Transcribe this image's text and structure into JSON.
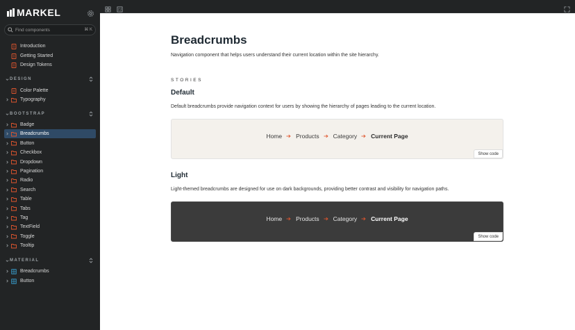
{
  "sidebar": {
    "brand": "MARKEL",
    "search": {
      "placeholder": "Find components",
      "shortcut": "⌘ K"
    },
    "top_items": [
      {
        "label": "Introduction",
        "icon": "document-icon"
      },
      {
        "label": "Getting Started",
        "icon": "document-icon"
      },
      {
        "label": "Design Tokens",
        "icon": "document-icon"
      }
    ],
    "sections": [
      {
        "title": "DESIGN",
        "items": [
          {
            "label": "Color Palette",
            "icon": "document-icon"
          },
          {
            "label": "Typography",
            "icon": "folder-icon"
          }
        ]
      },
      {
        "title": "BOOTSTRAP",
        "items": [
          {
            "label": "Badge"
          },
          {
            "label": "Breadcrumbs",
            "selected": true
          },
          {
            "label": "Button"
          },
          {
            "label": "Checkbox"
          },
          {
            "label": "Dropdown"
          },
          {
            "label": "Pagination"
          },
          {
            "label": "Radio"
          },
          {
            "label": "Search"
          },
          {
            "label": "Table"
          },
          {
            "label": "Tabs"
          },
          {
            "label": "Tag"
          },
          {
            "label": "TextField"
          },
          {
            "label": "Toggle"
          },
          {
            "label": "Tooltip"
          }
        ]
      },
      {
        "title": "MATERIAL",
        "items": [
          {
            "label": "Breadcrumbs",
            "icon": "component-icon"
          },
          {
            "label": "Button",
            "icon": "component-icon"
          }
        ]
      }
    ]
  },
  "page": {
    "title": "Breadcrumbs",
    "description": "Navigation component that helps users understand their current location within the site hierarchy.",
    "stories_label": "STORIES",
    "stories": [
      {
        "title": "Default",
        "description": "Default breadcrumbs provide navigation context for users by showing the hierarchy of pages leading to the current location.",
        "crumbs": [
          "Home",
          "Products",
          "Category",
          "Current Page"
        ],
        "show_code": "Show code",
        "theme": "light"
      },
      {
        "title": "Light",
        "description": "Light-themed breadcrumbs are designed for use on dark backgrounds, providing better contrast and visibility for navigation paths.",
        "crumbs": [
          "Home",
          "Products",
          "Category",
          "Current Page"
        ],
        "show_code": "Show code",
        "theme": "dark"
      }
    ]
  },
  "colors": {
    "sidebar_bg": "#222425",
    "selected_bg": "#2f4a66",
    "separator_arrow": "#e0562e",
    "light_preview_bg": "#f4f1ec",
    "dark_preview_bg": "#3b3b3b"
  }
}
